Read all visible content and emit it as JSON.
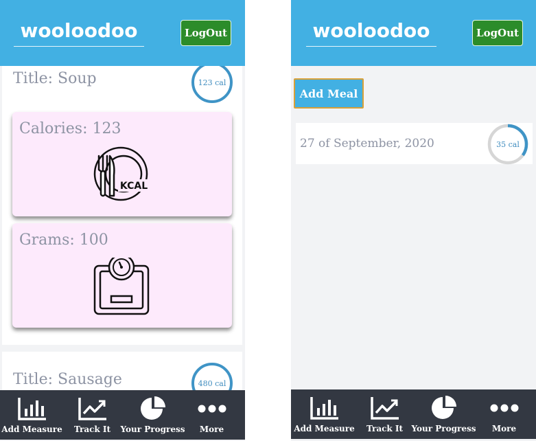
{
  "left_screen": {
    "header": {
      "brand": "wooloodoo",
      "logout_label": "LogOut"
    },
    "meals": [
      {
        "title": "Title: Soup",
        "calories_badge": "123 cal",
        "calories_label": "Calories: 123",
        "grams_label": "Grams: 100"
      },
      {
        "title": "Title: Sausage",
        "calories_badge": "480 cal"
      }
    ],
    "kcal_icon_text": "KCAL"
  },
  "right_screen": {
    "header": {
      "brand": "wooloodoo",
      "logout_label": "LogOut"
    },
    "add_meal_label": "Add Meal",
    "days": [
      {
        "date": "27 of September, 2020",
        "calories_badge": "35 cal",
        "progress": 0.35
      }
    ]
  },
  "nav": {
    "items": [
      {
        "label": "Add Measure",
        "icon": "bar-chart-icon"
      },
      {
        "label": "Track It",
        "icon": "trend-chart-icon"
      },
      {
        "label": "Your Progress",
        "icon": "pie-chart-icon"
      },
      {
        "label": "More",
        "icon": "more-dots-icon"
      }
    ]
  },
  "colors": {
    "header": "#42b0e3",
    "logout": "#2c8c2a",
    "ring": "#3f94c6",
    "card": "#fdeafc",
    "nav": "#333842"
  }
}
